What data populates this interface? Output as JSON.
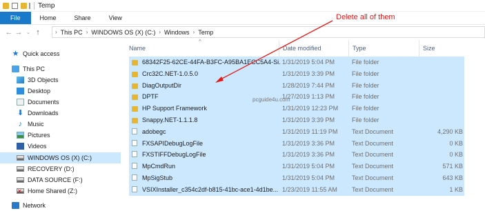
{
  "window": {
    "title": "Temp"
  },
  "ribbon": {
    "tabs": [
      "File",
      "Home",
      "Share",
      "View"
    ]
  },
  "address": {
    "crumbs": [
      "This PC",
      "WINDOWS OS (X) (C:)",
      "Windows",
      "Temp"
    ]
  },
  "nav": {
    "items": [
      {
        "label": "Quick access",
        "icon": "star-icon"
      },
      {
        "label": "This PC",
        "icon": "computer-icon"
      },
      {
        "label": "3D Objects",
        "icon": "3d-objects-icon"
      },
      {
        "label": "Desktop",
        "icon": "desktop-icon"
      },
      {
        "label": "Documents",
        "icon": "documents-icon"
      },
      {
        "label": "Downloads",
        "icon": "download-arrow-icon"
      },
      {
        "label": "Music",
        "icon": "music-note-icon"
      },
      {
        "label": "Pictures",
        "icon": "pictures-icon"
      },
      {
        "label": "Videos",
        "icon": "videos-icon"
      },
      {
        "label": "WINDOWS OS (X) (C:)",
        "icon": "drive-icon",
        "selected": true
      },
      {
        "label": "RECOVERY (D:)",
        "icon": "drive-icon"
      },
      {
        "label": "DATA SOURCE (F:)",
        "icon": "drive-icon"
      },
      {
        "label": "Home Shared (Z:)",
        "icon": "network-drive-disconnected-icon"
      },
      {
        "label": "Network",
        "icon": "network-icon"
      }
    ]
  },
  "columns": {
    "name": "Name",
    "date": "Date modified",
    "type": "Type",
    "size": "Size"
  },
  "files": [
    {
      "name": "68342F25-62CE-44FA-B3FC-A95BA1ECC5A4-Si...",
      "date": "1/31/2019 5:04 PM",
      "type": "File folder",
      "size": "",
      "kind": "folder"
    },
    {
      "name": "Crc32C.NET-1.0.5.0",
      "date": "1/31/2019 3:39 PM",
      "type": "File folder",
      "size": "",
      "kind": "folder"
    },
    {
      "name": "DiagOutputDir",
      "date": "1/28/2019 7:44 PM",
      "type": "File folder",
      "size": "",
      "kind": "folder"
    },
    {
      "name": "DPTF",
      "date": "1/27/2019 1:13 PM",
      "type": "File folder",
      "size": "",
      "kind": "folder"
    },
    {
      "name": "HP Support Framework",
      "date": "1/31/2019 12:23 PM",
      "type": "File folder",
      "size": "",
      "kind": "folder"
    },
    {
      "name": "Snappy.NET-1.1.1.8",
      "date": "1/31/2019 3:39 PM",
      "type": "File folder",
      "size": "",
      "kind": "folder"
    },
    {
      "name": "adobegc",
      "date": "1/31/2019 11:19 PM",
      "type": "Text Document",
      "size": "4,290 KB",
      "kind": "text"
    },
    {
      "name": "FXSAPIDebugLogFile",
      "date": "1/31/2019 3:36 PM",
      "type": "Text Document",
      "size": "0 KB",
      "kind": "text"
    },
    {
      "name": "FXSTIFFDebugLogFile",
      "date": "1/31/2019 3:36 PM",
      "type": "Text Document",
      "size": "0 KB",
      "kind": "text"
    },
    {
      "name": "MpCmdRun",
      "date": "1/31/2019 5:04 PM",
      "type": "Text Document",
      "size": "571 KB",
      "kind": "text"
    },
    {
      "name": "MpSigStub",
      "date": "1/31/2019 5:04 PM",
      "type": "Text Document",
      "size": "643 KB",
      "kind": "text"
    },
    {
      "name": "VSIXInstaller_c354c2df-b815-41bc-ace1-4d1be...",
      "date": "1/23/2019 11:55 AM",
      "type": "Text Document",
      "size": "1 KB",
      "kind": "text"
    }
  ],
  "annotation": {
    "text": "Delete all of them",
    "color": "#e11b1b"
  },
  "watermark": "pcguide4u.com",
  "colors": {
    "selection": "#cce8ff",
    "accent": "#1979ca",
    "folder": "#e8b530"
  }
}
